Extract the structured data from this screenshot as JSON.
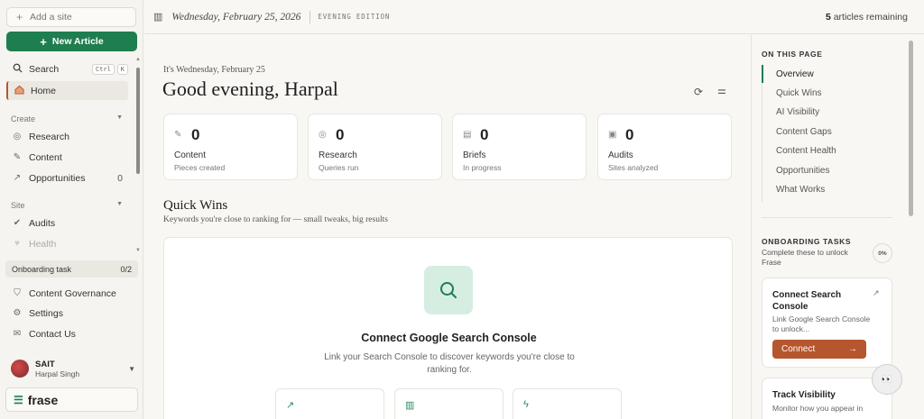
{
  "sidebar": {
    "add_site": "Add a site",
    "new_article": "New Article",
    "search_label": "Search",
    "search_kbd": [
      "Ctrl",
      "K"
    ],
    "home": "Home",
    "create_label": "Create",
    "research": "Research",
    "content": "Content",
    "opportunities": "Opportunities",
    "opportunities_count": "0",
    "site_label": "Site",
    "audits": "Audits",
    "health": "Health",
    "onboarding_task": "Onboarding task",
    "onboarding_count": "0/2",
    "content_governance": "Content Governance",
    "settings": "Settings",
    "contact_us": "Contact Us",
    "user_org": "SAIT",
    "user_name": "Harpal Singh",
    "brand": "frase"
  },
  "topbar": {
    "date": "Wednesday, February 25, 2026",
    "edition": "EVENING EDITION",
    "remaining_count": "5",
    "remaining_text": "articles remaining"
  },
  "main": {
    "greet_small": "It's Wednesday, February 25",
    "greet": "Good evening, Harpal",
    "stats": [
      {
        "value": "0",
        "label": "Content",
        "sub": "Pieces created"
      },
      {
        "value": "0",
        "label": "Research",
        "sub": "Queries run"
      },
      {
        "value": "0",
        "label": "Briefs",
        "sub": "In progress"
      },
      {
        "value": "0",
        "label": "Audits",
        "sub": "Sites analyzed"
      }
    ],
    "quick_wins_title": "Quick Wins",
    "quick_wins_sub": "Keywords you're close to ranking for — small tweaks, big results",
    "connect_title": "Connect Google Search Console",
    "connect_desc": "Link your Search Console to discover keywords you're close to ranking for."
  },
  "rail": {
    "on_this_page": "ON THIS PAGE",
    "toc": [
      "Overview",
      "Quick Wins",
      "AI Visibility",
      "Content Gaps",
      "Content Health",
      "Opportunities",
      "What Works"
    ],
    "onboarding_title": "ONBOARDING TASKS",
    "onboarding_sub": "Complete these to unlock Frase",
    "onboarding_pct": "0%",
    "task1_title": "Connect Search Console",
    "task1_desc": "Link Google Search Console to unlock...",
    "task1_button": "Connect",
    "task2_title": "Track Visibility",
    "task2_desc": "Monitor how you appear in"
  },
  "colors": {
    "brand_green": "#1e7e4f",
    "accent_orange": "#b5562e",
    "tile_mint": "#d6ede2"
  }
}
